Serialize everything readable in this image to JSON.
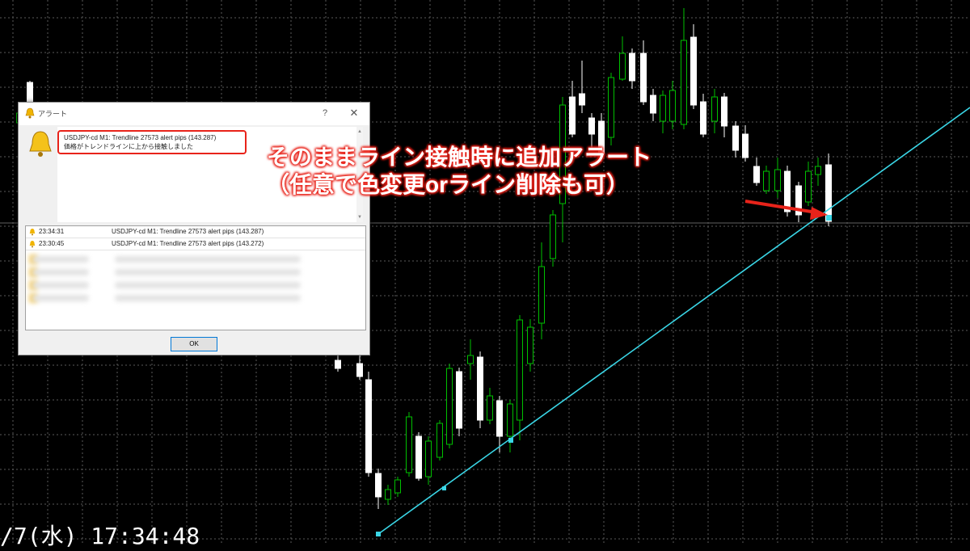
{
  "dialog": {
    "title": "アラート",
    "help_label": "?",
    "close_label": "✕",
    "message_line1": "USDJPY-cd M1: Trendline 27573 alert pips (143.287)",
    "message_line2": "価格がトレンドラインに上から接触しました",
    "ok_label": "OK"
  },
  "alerts": [
    {
      "time": "23:34:31",
      "message": "USDJPY-cd M1: Trendline 27573 alert pips (143.287)"
    },
    {
      "time": "23:30:45",
      "message": "USDJPY-cd M1: Trendline 27573 alert pips (143.272)"
    }
  ],
  "annotation": {
    "line1": "そのままライン接触時に追加アラート",
    "line2": "（任意で色変更orライン削除も可）"
  },
  "timestamp": "/7(水) 17:34:48",
  "colors": {
    "background": "#000000",
    "grid": "#5a5a5a",
    "bull_candle": "#00c000",
    "bear_candle": "#ffffff",
    "trendline": "#3ad6e6",
    "hline": "#5a5a5a",
    "annotation_red": "#e8231a"
  },
  "icons": {
    "title": "bell-icon",
    "message": "bell-icon",
    "row": "bell-icon",
    "close": "close-icon",
    "help": "help-icon"
  }
}
